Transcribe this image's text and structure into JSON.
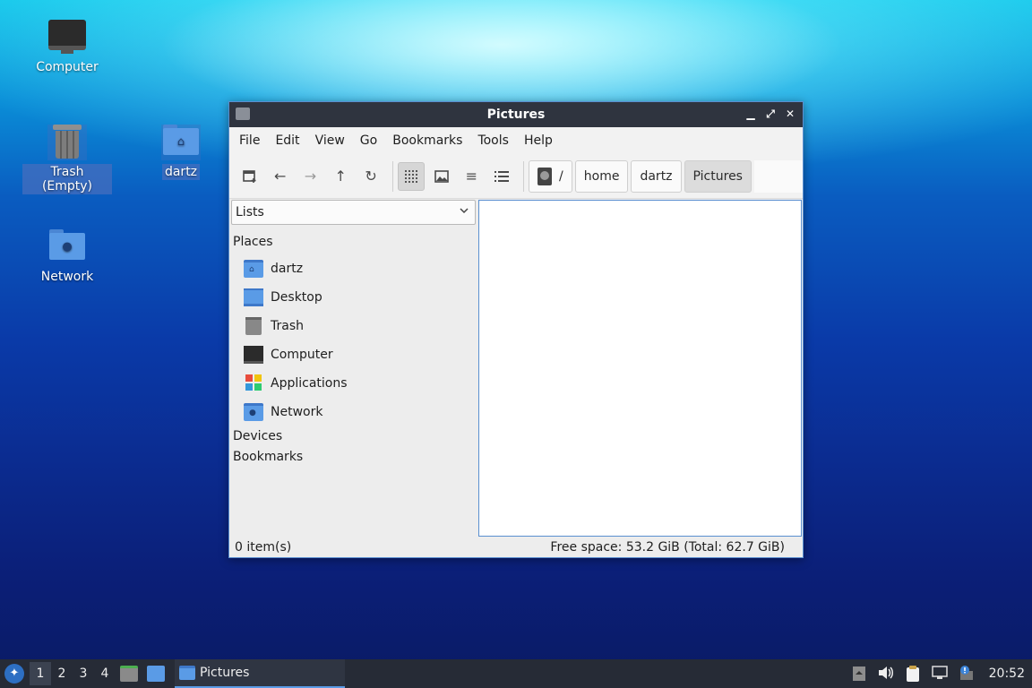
{
  "desktop": {
    "icons": [
      {
        "label": "Computer",
        "icon": "computer-icon"
      },
      {
        "label": "Trash (Empty)",
        "icon": "trash-icon"
      },
      {
        "label": "dartz",
        "icon": "home-folder-icon"
      },
      {
        "label": "Network",
        "icon": "network-icon"
      }
    ]
  },
  "window": {
    "title": "Pictures",
    "controls": {
      "minimize": "▁",
      "maximize": "⤢",
      "close": "✕"
    },
    "menu": [
      "File",
      "Edit",
      "View",
      "Go",
      "Bookmarks",
      "Tools",
      "Help"
    ],
    "toolbar": {
      "new_tab": "new-tab-icon",
      "back": "←",
      "forward": "→",
      "up": "↑",
      "reload": "↻",
      "icon_view": "icon-view-icon",
      "thumb_view": "thumbnail-view-icon",
      "compact_view": "≡",
      "list_view": "list-view-icon"
    },
    "path": [
      {
        "label": "/"
      },
      {
        "label": "home"
      },
      {
        "label": "dartz"
      },
      {
        "label": "Pictures"
      }
    ],
    "side": {
      "mode": "Lists",
      "places_header": "Places",
      "places": [
        {
          "label": "dartz",
          "icon": "home-folder-icon"
        },
        {
          "label": "Desktop",
          "icon": "desktop-icon"
        },
        {
          "label": "Trash",
          "icon": "trash-icon"
        },
        {
          "label": "Computer",
          "icon": "computer-icon"
        },
        {
          "label": "Applications",
          "icon": "applications-icon"
        },
        {
          "label": "Network",
          "icon": "network-icon"
        }
      ],
      "devices_header": "Devices",
      "bookmarks_header": "Bookmarks"
    },
    "status": {
      "items": "0 item(s)",
      "free_space": "Free space: 53.2 GiB (Total: 62.7 GiB)"
    }
  },
  "taskbar": {
    "workspaces": [
      "1",
      "2",
      "3",
      "4"
    ],
    "active_workspace": "1",
    "task_label": "Pictures",
    "clock": "20:52"
  }
}
